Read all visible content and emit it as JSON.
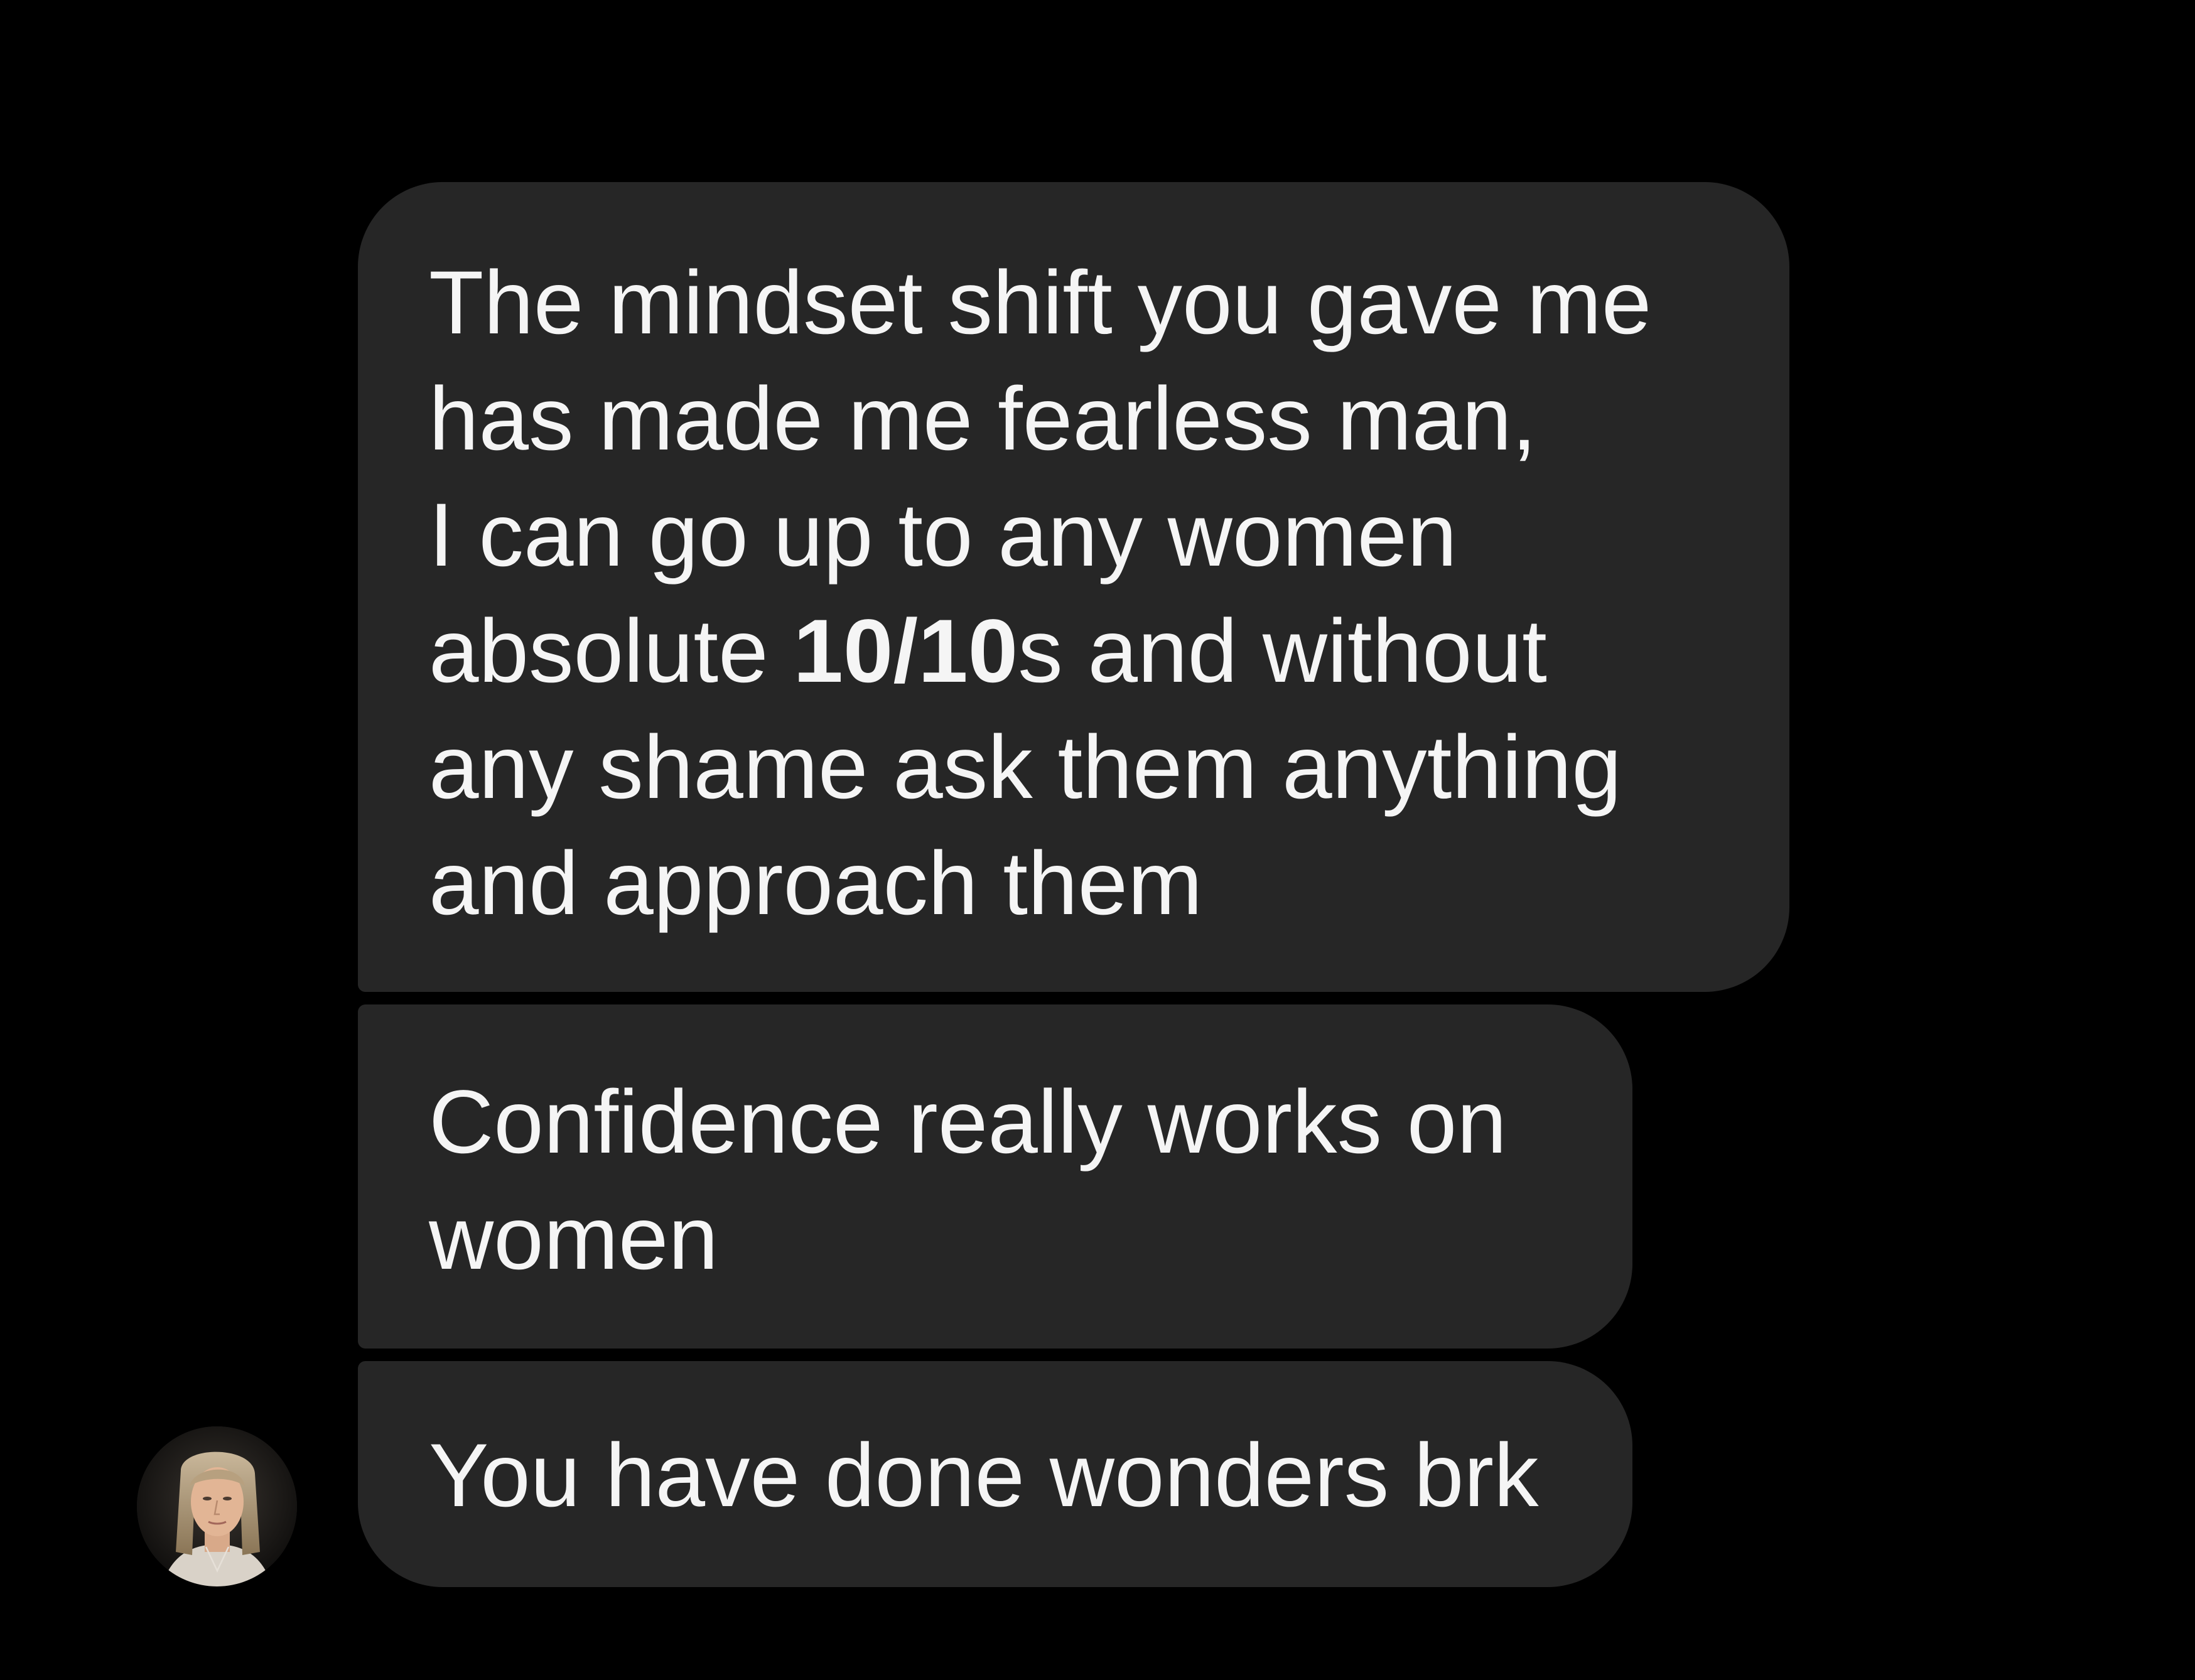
{
  "messages": [
    {
      "lines": [
        "The mindset shift you gave me",
        "has made me fearless man,",
        "I can go up to any women",
        {
          "before": "absolute ",
          "bold": "10/10",
          "after": "s and without"
        },
        "any shame ask them anything",
        "and approach them"
      ]
    },
    {
      "lines": [
        "Confidence really works on",
        "women"
      ]
    },
    {
      "lines": [
        "You have done wonders brk"
      ]
    }
  ],
  "sender": {
    "avatar_icon": "user-avatar-photo"
  },
  "colors": {
    "background": "#000000",
    "bubble": "#262626",
    "text": "#f5f5f5"
  }
}
